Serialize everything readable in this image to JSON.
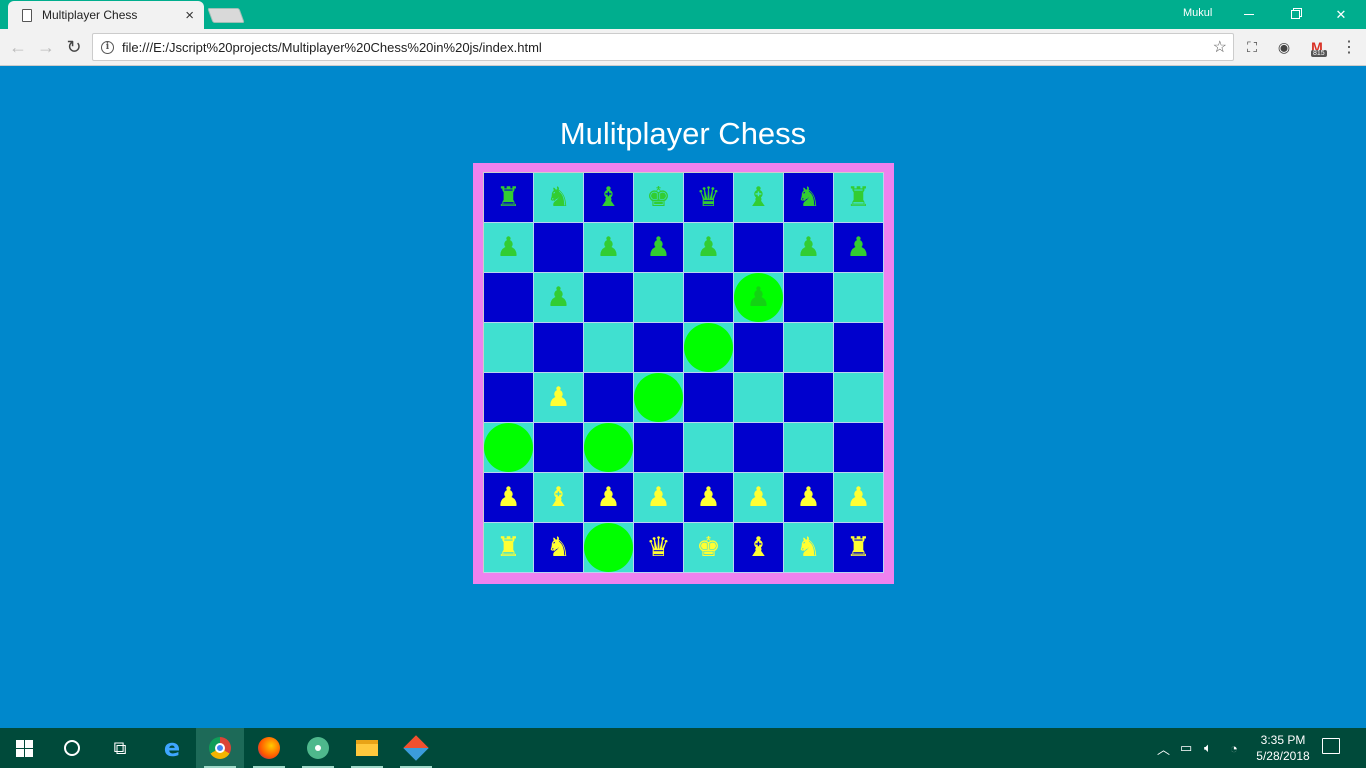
{
  "browser": {
    "tab_title": "Multiplayer Chess",
    "tab_close": "×",
    "profile_name": "Mukul",
    "url": "file:///E:/Jscript%20projects/Multiplayer%20Chess%20in%20js/index.html",
    "gmail_badge": "815"
  },
  "page": {
    "title": "Mulitplayer Chess"
  },
  "colors": {
    "page_bg": "#0088CC",
    "board_frame": "#EE82EE",
    "light_square": "#40E0D0",
    "dark_square": "#0000CD",
    "move_marker": "#00FF00",
    "green_pieces": "#32CD32",
    "yellow_pieces": "#FFFF33"
  },
  "board": {
    "rows": [
      [
        {
          "p": "♜",
          "c": "green"
        },
        {
          "p": "♞",
          "c": "green"
        },
        {
          "p": "♝",
          "c": "green"
        },
        {
          "p": "♚",
          "c": "green"
        },
        {
          "p": "♛",
          "c": "green"
        },
        {
          "p": "♝",
          "c": "green"
        },
        {
          "p": "♞",
          "c": "green"
        },
        {
          "p": "♜",
          "c": "green"
        }
      ],
      [
        {
          "p": "♟",
          "c": "green"
        },
        {
          "p": "",
          "c": ""
        },
        {
          "p": "♟",
          "c": "green"
        },
        {
          "p": "♟",
          "c": "green"
        },
        {
          "p": "♟",
          "c": "green"
        },
        {
          "p": "",
          "c": ""
        },
        {
          "p": "♟",
          "c": "green"
        },
        {
          "p": "♟",
          "c": "green"
        }
      ],
      [
        {
          "p": "",
          "c": ""
        },
        {
          "p": "♟",
          "c": "green"
        },
        {
          "p": "",
          "c": ""
        },
        {
          "p": "",
          "c": ""
        },
        {
          "p": "",
          "c": ""
        },
        {
          "p": "♟",
          "c": "faded",
          "m": true
        },
        {
          "p": "",
          "c": ""
        },
        {
          "p": "",
          "c": ""
        }
      ],
      [
        {
          "p": "",
          "c": ""
        },
        {
          "p": "",
          "c": ""
        },
        {
          "p": "",
          "c": ""
        },
        {
          "p": "",
          "c": ""
        },
        {
          "p": "",
          "c": "",
          "m": true
        },
        {
          "p": "",
          "c": ""
        },
        {
          "p": "",
          "c": ""
        },
        {
          "p": "",
          "c": ""
        }
      ],
      [
        {
          "p": "",
          "c": ""
        },
        {
          "p": "♟",
          "c": "yellow"
        },
        {
          "p": "",
          "c": ""
        },
        {
          "p": "",
          "c": "",
          "m": true
        },
        {
          "p": "",
          "c": ""
        },
        {
          "p": "",
          "c": ""
        },
        {
          "p": "",
          "c": ""
        },
        {
          "p": "",
          "c": ""
        }
      ],
      [
        {
          "p": "",
          "c": "",
          "m": true
        },
        {
          "p": "",
          "c": ""
        },
        {
          "p": "",
          "c": "",
          "m": true
        },
        {
          "p": "",
          "c": ""
        },
        {
          "p": "",
          "c": ""
        },
        {
          "p": "",
          "c": ""
        },
        {
          "p": "",
          "c": ""
        },
        {
          "p": "",
          "c": ""
        }
      ],
      [
        {
          "p": "♟",
          "c": "yellow"
        },
        {
          "p": "♝",
          "c": "yellow"
        },
        {
          "p": "♟",
          "c": "yellow"
        },
        {
          "p": "♟",
          "c": "yellow"
        },
        {
          "p": "♟",
          "c": "yellow"
        },
        {
          "p": "♟",
          "c": "yellow"
        },
        {
          "p": "♟",
          "c": "yellow"
        },
        {
          "p": "♟",
          "c": "yellow"
        }
      ],
      [
        {
          "p": "♜",
          "c": "yellow"
        },
        {
          "p": "♞",
          "c": "yellow"
        },
        {
          "p": "",
          "c": "",
          "m": true
        },
        {
          "p": "♛",
          "c": "yellow"
        },
        {
          "p": "♚",
          "c": "yellow"
        },
        {
          "p": "♝",
          "c": "yellow"
        },
        {
          "p": "♞",
          "c": "yellow"
        },
        {
          "p": "♜",
          "c": "yellow"
        }
      ]
    ]
  },
  "taskbar": {
    "time": "3:35 PM",
    "date": "5/28/2018"
  }
}
